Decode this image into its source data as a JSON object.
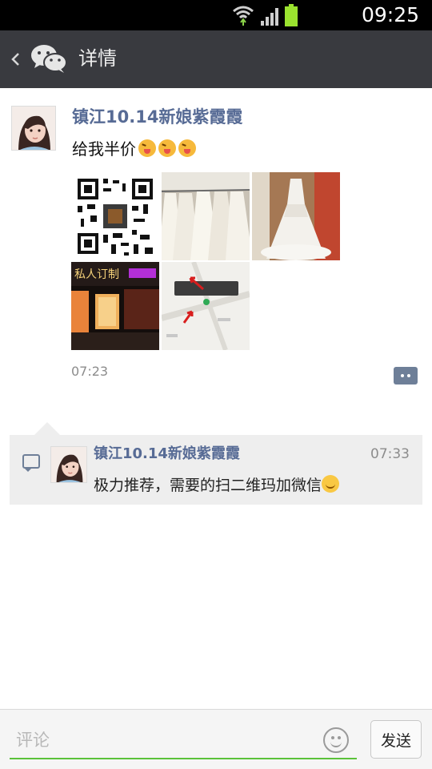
{
  "status_bar": {
    "time": "09:25"
  },
  "app_bar": {
    "back_icon": "chevron-left-icon",
    "logo_icon": "wechat-icon",
    "title": "详情"
  },
  "post": {
    "author": "镇江10.14新娘紫霞霞",
    "text": "给我半价",
    "emoji_count": 3,
    "photos": [
      {
        "name": "qr-code-photo",
        "kind": "qr"
      },
      {
        "name": "wedding-dress-rack-photo",
        "kind": "dresses"
      },
      {
        "name": "wedding-gown-photo",
        "kind": "gown"
      },
      {
        "name": "storefront-night-photo",
        "kind": "store"
      },
      {
        "name": "map-screenshot-photo",
        "kind": "map"
      }
    ],
    "time": "07:23"
  },
  "comment": {
    "author": "镇江10.14新娘紫霞霞",
    "time": "07:33",
    "text": "极力推荐，需要的扫二维玛加微信"
  },
  "input_bar": {
    "placeholder": "评论",
    "send_label": "发送"
  },
  "colors": {
    "nav_background": "#393a3f",
    "link_name": "#576b95",
    "input_accent": "#5bc23a",
    "comment_background": "#eeeeee"
  }
}
